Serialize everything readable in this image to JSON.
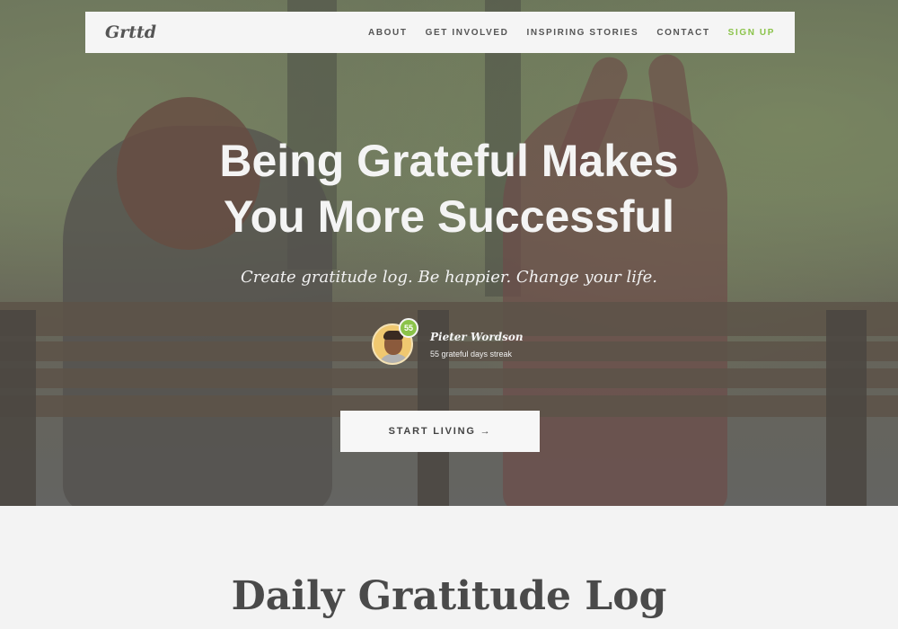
{
  "nav": {
    "logo": "Grttd",
    "links": [
      "ABOUT",
      "GET INVOLVED",
      "INSPIRING STORIES",
      "CONTACT"
    ],
    "signup": "SIGN UP"
  },
  "hero": {
    "headline_line1": "Being Grateful Makes",
    "headline_line2": "You More Successful",
    "tagline": "Create gratitude log. Be happier. Change your life.",
    "user": {
      "name": "Pieter Wordson",
      "streak_count": "55",
      "streak_text": "55 grateful days streak"
    },
    "cta": "START LIVING →"
  },
  "section": {
    "title": "Daily Gratitude Log"
  },
  "colors": {
    "accent": "#8bc34a",
    "nav_bg": "#f5f5f5",
    "page_bg": "#f3f3f3"
  }
}
